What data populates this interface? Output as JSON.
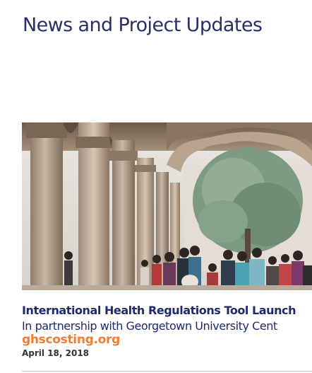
{
  "page": {
    "title": "News and Project Updates"
  },
  "news": [
    {
      "image": "photo of stone columns and arches with people gathered under a tree",
      "headline": "International Health Regulations Tool Launch",
      "summary": "In partnership with Georgetown University Cent",
      "link_text": "ghscosting.org",
      "date": "April 18, 2018"
    }
  ],
  "colors": {
    "title": "#27306a",
    "headline": "#1f2a6e",
    "link": "#f07d32",
    "date": "#333333",
    "divider": "#c8c8c8"
  }
}
